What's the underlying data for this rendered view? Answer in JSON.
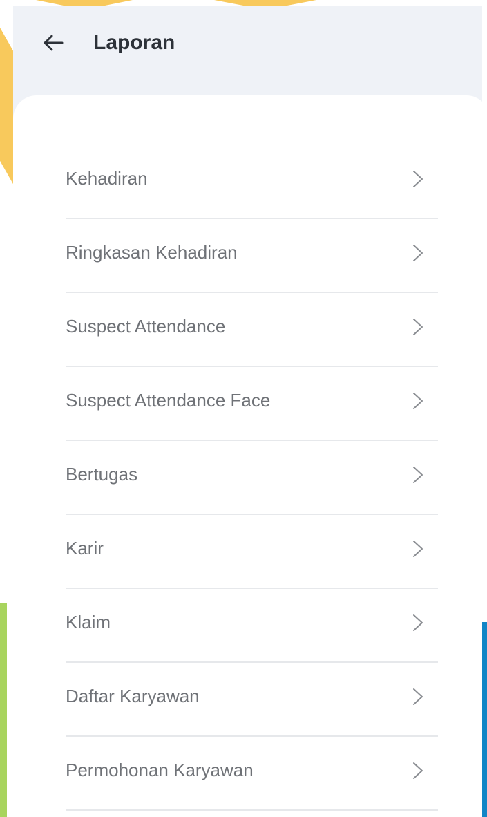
{
  "header": {
    "back_icon": "arrow-left-icon",
    "title": "Laporan"
  },
  "menu": {
    "chevron_icon": "chevron-right-icon",
    "items": [
      {
        "label": "Kehadiran"
      },
      {
        "label": "Ringkasan Kehadiran"
      },
      {
        "label": "Suspect Attendance"
      },
      {
        "label": "Suspect Attendance Face"
      },
      {
        "label": "Bertugas"
      },
      {
        "label": "Karir"
      },
      {
        "label": "Klaim"
      },
      {
        "label": "Daftar Karyawan"
      },
      {
        "label": "Permohonan Karyawan"
      }
    ]
  },
  "colors": {
    "background": "#eff2f7",
    "card": "#ffffff",
    "title_text": "#2d3239",
    "item_text": "#6f7277",
    "divider": "#e6e8eb",
    "deco_yellow": "#f8c95c",
    "deco_green": "#a8d45e",
    "deco_blue": "#1185c6"
  }
}
